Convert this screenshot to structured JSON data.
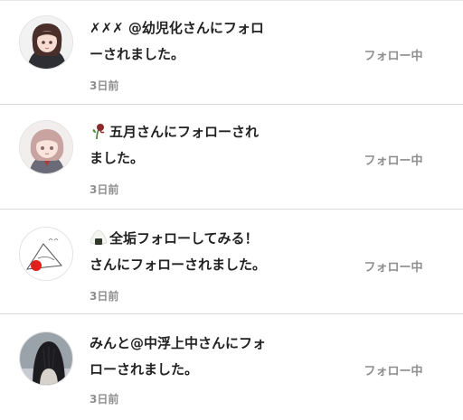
{
  "notifications": [
    {
      "avatar": "anime-girl-black-hoodie-avatar",
      "line1": "✗✗✗ @幼児化さんにフォロ",
      "line2": "ーされました。",
      "time": "3日前",
      "button": "フォロー中"
    },
    {
      "avatar": "anime-girl-pink-hair-avatar",
      "emoji": "wilted-rose-icon",
      "line1": "五月さんにフォローされ",
      "line2": "ました。",
      "time": "3日前",
      "button": "フォロー中"
    },
    {
      "avatar": "onigiri-drawing-avatar",
      "emoji": "rice-ball-icon",
      "line1": "全垢フォローしてみる！",
      "line2": "さんにフォローされました。",
      "time": "3日前",
      "button": "フォロー中"
    },
    {
      "avatar": "dark-hair-photo-avatar",
      "line1": "みんと@中浮上中さんにフォ",
      "line2": "ローされました。",
      "time": "3日前",
      "button": "フォロー中"
    }
  ]
}
